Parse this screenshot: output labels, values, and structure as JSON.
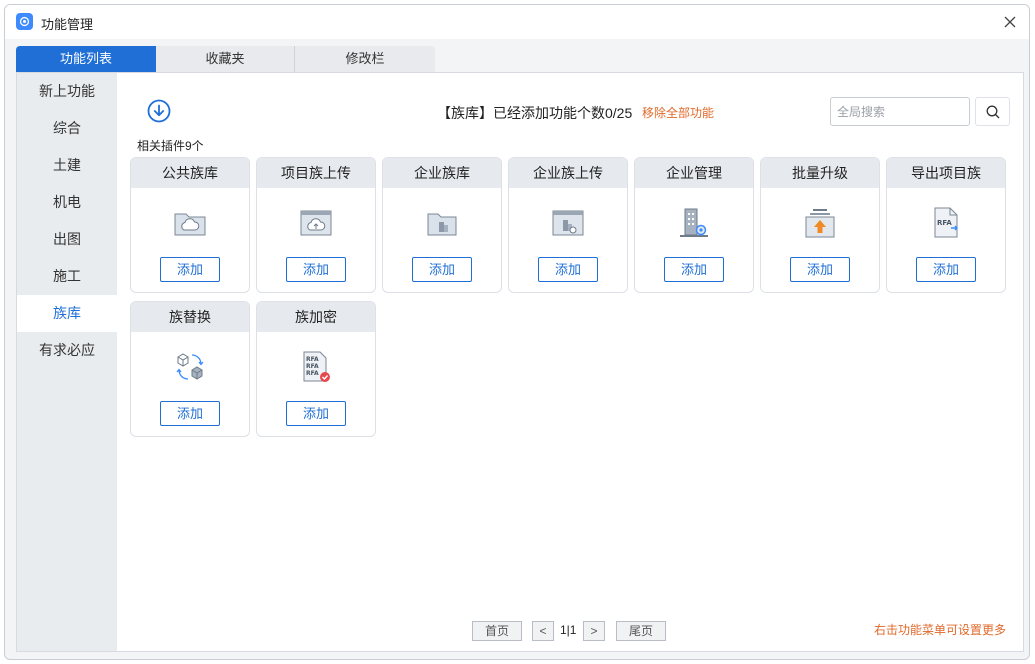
{
  "window": {
    "title": "功能管理",
    "accent": "#1f6fd6"
  },
  "tabs": [
    {
      "label": "功能列表",
      "active": true
    },
    {
      "label": "收藏夹",
      "active": false
    },
    {
      "label": "修改栏",
      "active": false
    }
  ],
  "sidebar": {
    "items": [
      {
        "label": "新上功能"
      },
      {
        "label": "综合"
      },
      {
        "label": "土建"
      },
      {
        "label": "机电"
      },
      {
        "label": "出图"
      },
      {
        "label": "施工"
      },
      {
        "label": "族库",
        "active": true
      },
      {
        "label": "有求必应"
      }
    ]
  },
  "header": {
    "counter_text": "【族库】已经添加功能个数0/25",
    "remove_all": "移除全部功能",
    "search_placeholder": "全局搜索",
    "plugin_count": "相关插件9个"
  },
  "cards": [
    {
      "title": "公共族库",
      "add_label": "添加",
      "icon": "cloud-folder-icon"
    },
    {
      "title": "项目族上传",
      "add_label": "添加",
      "icon": "cloud-upload-icon"
    },
    {
      "title": "企业族库",
      "add_label": "添加",
      "icon": "building-folder-icon"
    },
    {
      "title": "企业族上传",
      "add_label": "添加",
      "icon": "building-upload-icon"
    },
    {
      "title": "企业管理",
      "add_label": "添加",
      "icon": "building-gear-icon"
    },
    {
      "title": "批量升级",
      "add_label": "添加",
      "icon": "upgrade-arrow-icon"
    },
    {
      "title": "导出项目族",
      "add_label": "添加",
      "icon": "rfa-export-icon"
    },
    {
      "title": "族替换",
      "add_label": "添加",
      "icon": "cube-replace-icon"
    },
    {
      "title": "族加密",
      "add_label": "添加",
      "icon": "rfa-encrypt-icon"
    }
  ],
  "pagination": {
    "first": "首页",
    "prev": "<",
    "current": "1|1",
    "next": ">",
    "last": "尾页"
  },
  "footer_hint": "右击功能菜单可设置更多"
}
